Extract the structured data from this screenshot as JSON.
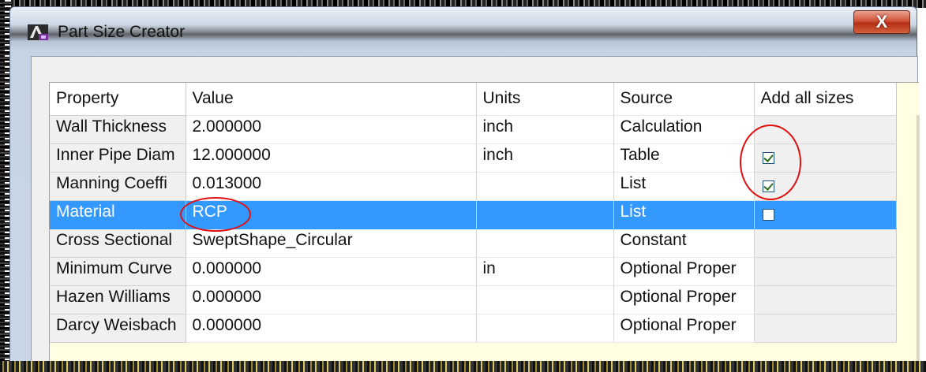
{
  "window": {
    "title": "Part Size Creator",
    "close_label": "X",
    "app_icon": "civil3d-app-icon"
  },
  "grid": {
    "columns": [
      "Property",
      "Value",
      "Units",
      "Source",
      "Add all sizes"
    ],
    "rows": [
      {
        "property": "Wall Thickness",
        "value": "2.000000",
        "units": "inch",
        "source": "Calculation",
        "add_all": null,
        "selected": false
      },
      {
        "property": "Inner Pipe Diam",
        "value": "12.000000",
        "units": "inch",
        "source": "Table",
        "add_all": true,
        "selected": false
      },
      {
        "property": "Manning Coeffi",
        "value": "0.013000",
        "units": "",
        "source": "List",
        "add_all": true,
        "selected": false
      },
      {
        "property": "Material",
        "value": "RCP",
        "units": "",
        "source": "List",
        "add_all": false,
        "selected": true
      },
      {
        "property": "Cross Sectional",
        "value": "SweptShape_Circular",
        "units": "",
        "source": "Constant",
        "add_all": null,
        "selected": false
      },
      {
        "property": "Minimum Curve",
        "value": "0.000000",
        "units": "in",
        "source": "Optional Proper",
        "add_all": null,
        "selected": false
      },
      {
        "property": "Hazen Williams",
        "value": "0.000000",
        "units": "",
        "source": "Optional Proper",
        "add_all": null,
        "selected": false
      },
      {
        "property": "Darcy Weisbach",
        "value": "0.000000",
        "units": "",
        "source": "Optional Proper",
        "add_all": null,
        "selected": false
      }
    ]
  },
  "colors": {
    "selection": "#3399ff",
    "annotation": "#e01010",
    "close_button": "#c83a22"
  }
}
